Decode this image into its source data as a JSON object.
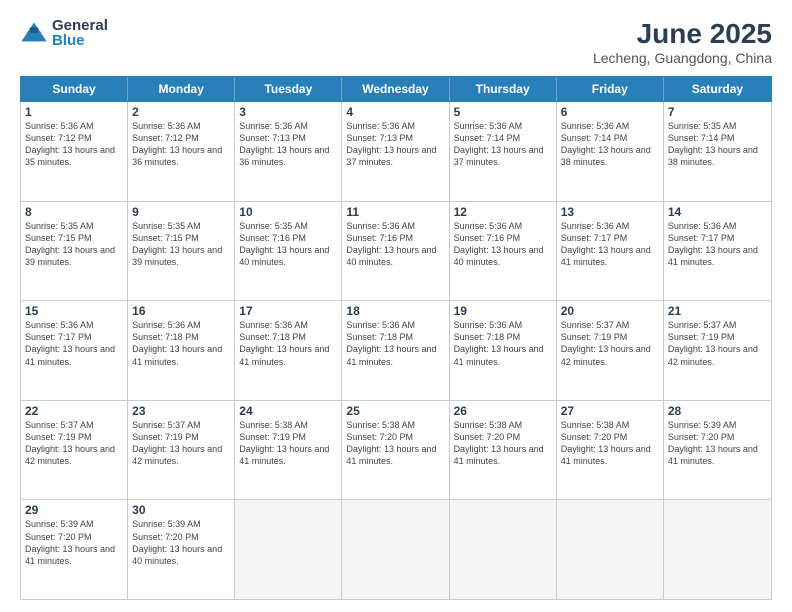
{
  "logo": {
    "general": "General",
    "blue": "Blue"
  },
  "title": "June 2025",
  "location": "Lecheng, Guangdong, China",
  "days": [
    "Sunday",
    "Monday",
    "Tuesday",
    "Wednesday",
    "Thursday",
    "Friday",
    "Saturday"
  ],
  "weeks": [
    [
      {
        "day": "1",
        "sunrise": "5:36 AM",
        "sunset": "7:12 PM",
        "daylight": "13 hours and 35 minutes."
      },
      {
        "day": "2",
        "sunrise": "5:36 AM",
        "sunset": "7:12 PM",
        "daylight": "13 hours and 36 minutes."
      },
      {
        "day": "3",
        "sunrise": "5:36 AM",
        "sunset": "7:13 PM",
        "daylight": "13 hours and 36 minutes."
      },
      {
        "day": "4",
        "sunrise": "5:36 AM",
        "sunset": "7:13 PM",
        "daylight": "13 hours and 37 minutes."
      },
      {
        "day": "5",
        "sunrise": "5:36 AM",
        "sunset": "7:14 PM",
        "daylight": "13 hours and 37 minutes."
      },
      {
        "day": "6",
        "sunrise": "5:36 AM",
        "sunset": "7:14 PM",
        "daylight": "13 hours and 38 minutes."
      },
      {
        "day": "7",
        "sunrise": "5:35 AM",
        "sunset": "7:14 PM",
        "daylight": "13 hours and 38 minutes."
      }
    ],
    [
      {
        "day": "8",
        "sunrise": "5:35 AM",
        "sunset": "7:15 PM",
        "daylight": "13 hours and 39 minutes."
      },
      {
        "day": "9",
        "sunrise": "5:35 AM",
        "sunset": "7:15 PM",
        "daylight": "13 hours and 39 minutes."
      },
      {
        "day": "10",
        "sunrise": "5:35 AM",
        "sunset": "7:16 PM",
        "daylight": "13 hours and 40 minutes."
      },
      {
        "day": "11",
        "sunrise": "5:36 AM",
        "sunset": "7:16 PM",
        "daylight": "13 hours and 40 minutes."
      },
      {
        "day": "12",
        "sunrise": "5:36 AM",
        "sunset": "7:16 PM",
        "daylight": "13 hours and 40 minutes."
      },
      {
        "day": "13",
        "sunrise": "5:36 AM",
        "sunset": "7:17 PM",
        "daylight": "13 hours and 41 minutes."
      },
      {
        "day": "14",
        "sunrise": "5:36 AM",
        "sunset": "7:17 PM",
        "daylight": "13 hours and 41 minutes."
      }
    ],
    [
      {
        "day": "15",
        "sunrise": "5:36 AM",
        "sunset": "7:17 PM",
        "daylight": "13 hours and 41 minutes."
      },
      {
        "day": "16",
        "sunrise": "5:36 AM",
        "sunset": "7:18 PM",
        "daylight": "13 hours and 41 minutes."
      },
      {
        "day": "17",
        "sunrise": "5:36 AM",
        "sunset": "7:18 PM",
        "daylight": "13 hours and 41 minutes."
      },
      {
        "day": "18",
        "sunrise": "5:36 AM",
        "sunset": "7:18 PM",
        "daylight": "13 hours and 41 minutes."
      },
      {
        "day": "19",
        "sunrise": "5:36 AM",
        "sunset": "7:18 PM",
        "daylight": "13 hours and 41 minutes."
      },
      {
        "day": "20",
        "sunrise": "5:37 AM",
        "sunset": "7:19 PM",
        "daylight": "13 hours and 42 minutes."
      },
      {
        "day": "21",
        "sunrise": "5:37 AM",
        "sunset": "7:19 PM",
        "daylight": "13 hours and 42 minutes."
      }
    ],
    [
      {
        "day": "22",
        "sunrise": "5:37 AM",
        "sunset": "7:19 PM",
        "daylight": "13 hours and 42 minutes."
      },
      {
        "day": "23",
        "sunrise": "5:37 AM",
        "sunset": "7:19 PM",
        "daylight": "13 hours and 42 minutes."
      },
      {
        "day": "24",
        "sunrise": "5:38 AM",
        "sunset": "7:19 PM",
        "daylight": "13 hours and 41 minutes."
      },
      {
        "day": "25",
        "sunrise": "5:38 AM",
        "sunset": "7:20 PM",
        "daylight": "13 hours and 41 minutes."
      },
      {
        "day": "26",
        "sunrise": "5:38 AM",
        "sunset": "7:20 PM",
        "daylight": "13 hours and 41 minutes."
      },
      {
        "day": "27",
        "sunrise": "5:38 AM",
        "sunset": "7:20 PM",
        "daylight": "13 hours and 41 minutes."
      },
      {
        "day": "28",
        "sunrise": "5:39 AM",
        "sunset": "7:20 PM",
        "daylight": "13 hours and 41 minutes."
      }
    ],
    [
      {
        "day": "29",
        "sunrise": "5:39 AM",
        "sunset": "7:20 PM",
        "daylight": "13 hours and 41 minutes."
      },
      {
        "day": "30",
        "sunrise": "5:39 AM",
        "sunset": "7:20 PM",
        "daylight": "13 hours and 40 minutes."
      },
      {
        "day": "",
        "sunrise": "",
        "sunset": "",
        "daylight": ""
      },
      {
        "day": "",
        "sunrise": "",
        "sunset": "",
        "daylight": ""
      },
      {
        "day": "",
        "sunrise": "",
        "sunset": "",
        "daylight": ""
      },
      {
        "day": "",
        "sunrise": "",
        "sunset": "",
        "daylight": ""
      },
      {
        "day": "",
        "sunrise": "",
        "sunset": "",
        "daylight": ""
      }
    ]
  ]
}
